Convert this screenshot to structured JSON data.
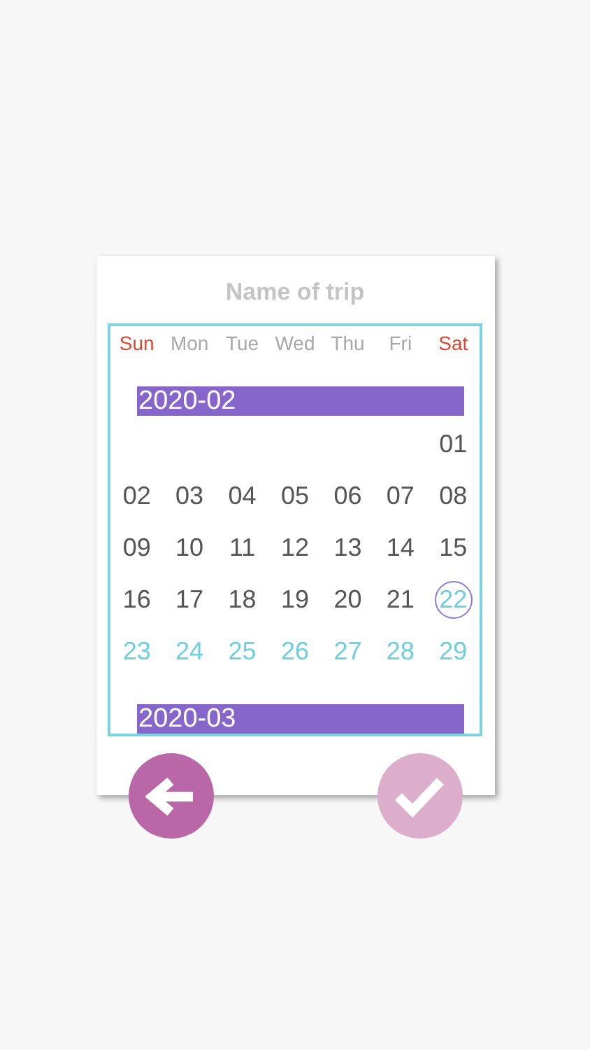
{
  "title": "Name of trip",
  "weekdays": [
    {
      "label": "Sun",
      "weekend": true
    },
    {
      "label": "Mon",
      "weekend": false
    },
    {
      "label": "Tue",
      "weekend": false
    },
    {
      "label": "Wed",
      "weekend": false
    },
    {
      "label": "Thu",
      "weekend": false
    },
    {
      "label": "Fri",
      "weekend": false
    },
    {
      "label": "Sat",
      "weekend": true
    }
  ],
  "months": [
    {
      "label": "2020-02",
      "days": [
        {
          "label": "01",
          "kind": "past"
        },
        {
          "label": "02",
          "kind": "past"
        },
        {
          "label": "03",
          "kind": "past"
        },
        {
          "label": "04",
          "kind": "past"
        },
        {
          "label": "05",
          "kind": "past"
        },
        {
          "label": "06",
          "kind": "past"
        },
        {
          "label": "07",
          "kind": "past"
        },
        {
          "label": "08",
          "kind": "past"
        },
        {
          "label": "09",
          "kind": "past"
        },
        {
          "label": "10",
          "kind": "past"
        },
        {
          "label": "11",
          "kind": "past"
        },
        {
          "label": "12",
          "kind": "past"
        },
        {
          "label": "13",
          "kind": "past"
        },
        {
          "label": "14",
          "kind": "past"
        },
        {
          "label": "15",
          "kind": "past"
        },
        {
          "label": "16",
          "kind": "past"
        },
        {
          "label": "17",
          "kind": "past"
        },
        {
          "label": "18",
          "kind": "past"
        },
        {
          "label": "19",
          "kind": "past"
        },
        {
          "label": "20",
          "kind": "past"
        },
        {
          "label": "21",
          "kind": "past"
        },
        {
          "label": "22",
          "kind": "today"
        },
        {
          "label": "23",
          "kind": "future"
        },
        {
          "label": "24",
          "kind": "future"
        },
        {
          "label": "25",
          "kind": "future"
        },
        {
          "label": "26",
          "kind": "future"
        },
        {
          "label": "27",
          "kind": "future"
        },
        {
          "label": "28",
          "kind": "future"
        },
        {
          "label": "29",
          "kind": "future"
        }
      ]
    },
    {
      "label": "2020-03"
    }
  ]
}
